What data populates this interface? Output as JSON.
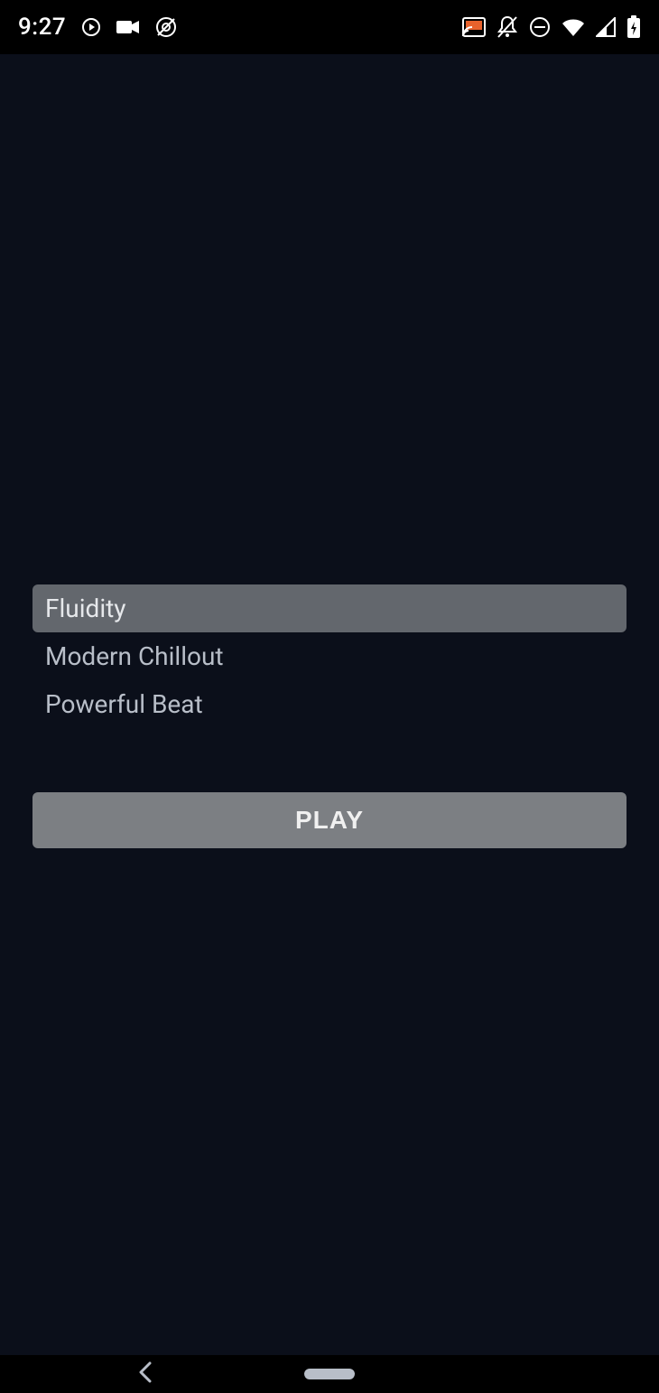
{
  "status": {
    "time": "9:27",
    "cast_active_color": "#e8622c"
  },
  "tracks": {
    "items": [
      {
        "label": "Fluidity",
        "selected": true
      },
      {
        "label": "Modern Chillout",
        "selected": false
      },
      {
        "label": "Powerful Beat",
        "selected": false
      }
    ]
  },
  "controls": {
    "play_label": "PLAY"
  }
}
